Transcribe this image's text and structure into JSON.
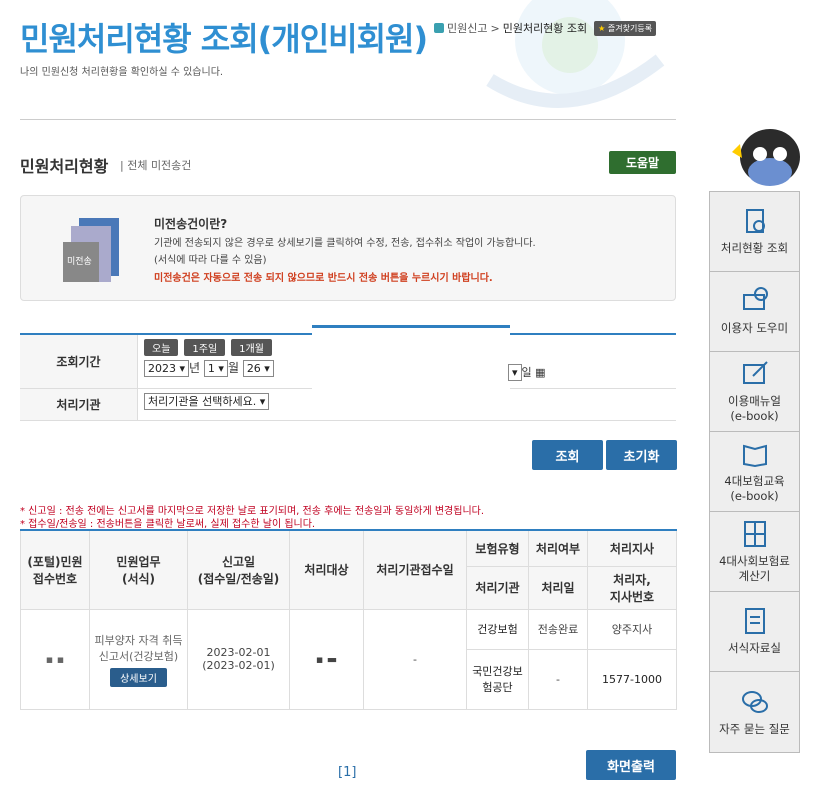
{
  "header": {
    "title": "민원처리현황 조회(개인비회원)",
    "subtitle": "나의 민원신청 처리현황을 확인하실 수 있습니다.",
    "breadcrumb": [
      "민원신고",
      "민원처리현황 조회"
    ],
    "bookmark": "즐겨찾기등록"
  },
  "section": {
    "title": "민원처리현황",
    "sub": "전체 미전송건",
    "help": "도움말"
  },
  "info": {
    "title": "미전송건이란?",
    "line1": "기관에 전송되지 않은 경우로 상세보기를 클릭하여 수정, 전송, 접수취소 작업이 가능합니다.",
    "line2": "(서식에 따라 다를 수 있음)",
    "warn": "미전송건은 자동으로 전송 되지 않으므로 반드시 전송 버튼을 누르시기 바랍니다.",
    "icon_label": "미전송"
  },
  "search": {
    "period_label": "조회기간",
    "quick": [
      "오늘",
      "1주일",
      "1개월"
    ],
    "year": "2023",
    "year_unit": "년",
    "month": "1",
    "month_unit": "월",
    "day": "26",
    "day_unit2": "일",
    "org_label": "처리기관",
    "org_placeholder": "처리기관을 선택하세요.",
    "btn_search": "조회",
    "btn_reset": "초기화"
  },
  "notes": [
    "* 신고일 : 전송 전에는 신고서를 마지막으로 저장한 날로 표기되며, 전송 후에는 전송일과 동일하게 변경됩니다.",
    "* 접수일/전송일 : 전송버튼을 클릭한 날로써, 실제 접수한 날이 됩니다."
  ],
  "table": {
    "headers": {
      "receipt": "(포털)민원\n접수번호",
      "task": "민원업무\n(서식)",
      "date": "신고일\n(접수일/전송일)",
      "target": "처리대상",
      "org_receipt": "처리기관접수일",
      "ins_type": "보험유형",
      "status": "처리여부",
      "branch": "처리지사",
      "org": "처리기관",
      "proc_date": "처리일",
      "branch_phone": "처리자,\n지사번호"
    },
    "row": {
      "task": "피부양자 자격 취득신고서(건강보험)",
      "detail": "상세보기",
      "date": "2023-02-01",
      "date2": "(2023-02-01)",
      "org_receipt": "-",
      "ins_type": "건강보험",
      "status": "전송완료",
      "branch": "양주지사",
      "org": "국민건강보험공단",
      "proc_date": "-",
      "phone": "1577-1000"
    }
  },
  "pager": "[1]",
  "print": "화면출력",
  "quick": [
    "처리현황 조회",
    "이용자 도우미",
    "이용매뉴얼\n(e-book)",
    "4대보험교육\n(e-book)",
    "4대사회보험료\n계산기",
    "서식자료실",
    "자주 묻는 질문"
  ]
}
